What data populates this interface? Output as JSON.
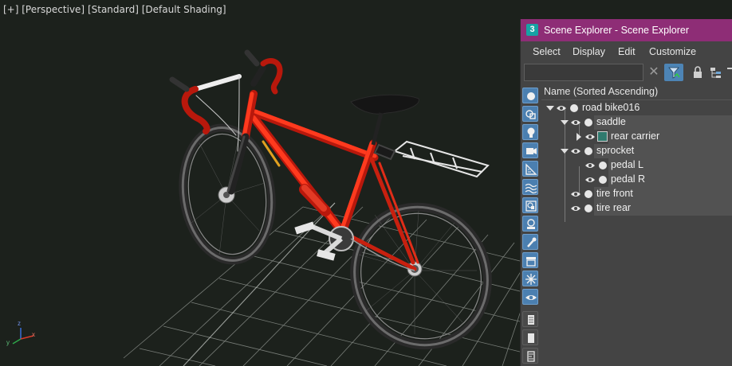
{
  "viewport": {
    "label_plus": "[+]",
    "label_view": "[Perspective]",
    "label_mode": "[Standard]",
    "label_shading": "[Default Shading]",
    "axis_x": "x",
    "axis_y": "y",
    "axis_z": "z"
  },
  "explorer": {
    "app_icon": "3",
    "title": "Scene Explorer - Scene Explorer",
    "menu": [
      "Select",
      "Display",
      "Edit",
      "Customize"
    ],
    "search": {
      "value": "",
      "placeholder": ""
    },
    "column_header": "Name (Sorted Ascending)",
    "side_buttons": [
      "display-none-icon",
      "geometry-icon",
      "lights-icon",
      "cameras-icon",
      "helpers-icon",
      "space-warps-icon",
      "groups-icon",
      "xrefs-icon",
      "bones-icon",
      "containers-icon",
      "frozen-icon",
      "hidden-icon",
      "select-all-icon",
      "select-none-icon",
      "invert-selection-icon"
    ],
    "tree": [
      {
        "label": "road bike016",
        "level": 0,
        "expanded": true,
        "highlight": false
      },
      {
        "label": "saddle",
        "level": 1,
        "expanded": true,
        "highlight": true
      },
      {
        "label": "rear carrier",
        "level": 2,
        "expanded": false,
        "highlight": true,
        "collapsed_arrow": true,
        "type_icon": "geometry-object-icon"
      },
      {
        "label": "sprocket",
        "level": 1,
        "expanded": true,
        "highlight": true
      },
      {
        "label": "pedal L",
        "level": 2,
        "expanded": false,
        "highlight": true
      },
      {
        "label": "pedal R",
        "level": 2,
        "expanded": false,
        "highlight": true
      },
      {
        "label": "tire front",
        "level": 1,
        "expanded": false,
        "highlight": true
      },
      {
        "label": "tire rear",
        "level": 1,
        "expanded": false,
        "highlight": true
      }
    ]
  },
  "colors": {
    "frame_red": "#e02d18",
    "title_bar": "#8e2d76",
    "accent_blue": "#4b7fb0",
    "viewport_bg": "#1c211c"
  }
}
